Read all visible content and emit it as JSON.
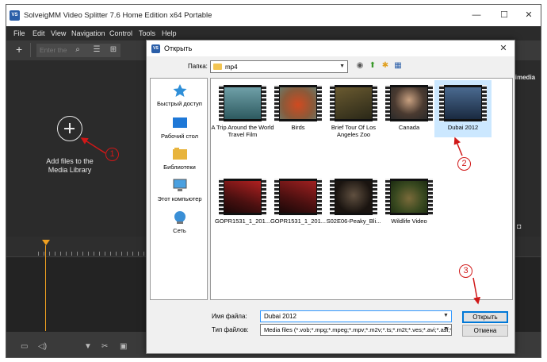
{
  "app": {
    "title": "SolveigMM Video Splitter 7.6 Home Edition x64 Portable",
    "icon_text": "VS",
    "window_buttons": [
      "—",
      "☐",
      "✕"
    ]
  },
  "menu": [
    "File",
    "Edit",
    "View",
    "Navigation",
    "Control",
    "Tools",
    "Help"
  ],
  "toolbar": {
    "search_placeholder": "Enter the"
  },
  "media_library": {
    "add_label_line1": "Add files to the",
    "add_label_line2": "Media Library"
  },
  "right_panel": {
    "label": "ultimedia"
  },
  "dialog": {
    "title": "Открыть",
    "look_in_label": "Папка:",
    "look_in_value": "mp4",
    "places": [
      {
        "label": "Быстрый доступ",
        "icon": "star-icon"
      },
      {
        "label": "Рабочий стол",
        "icon": "desktop-icon"
      },
      {
        "label": "Библиотеки",
        "icon": "library-icon"
      },
      {
        "label": "Этот компьютер",
        "icon": "computer-icon"
      },
      {
        "label": "Сеть",
        "icon": "network-icon"
      }
    ],
    "files": [
      {
        "name": "A Trip Around the World Travel Film",
        "selected": false
      },
      {
        "name": "Birds",
        "selected": false
      },
      {
        "name": "Brief Tour Of Los Angeles Zoo",
        "selected": false
      },
      {
        "name": "Canada",
        "selected": false
      },
      {
        "name": "Dubai 2012",
        "selected": true
      },
      {
        "name": "GOPR1531_1_201...",
        "selected": false
      },
      {
        "name": "GOPR1531_1_201...",
        "selected": false
      },
      {
        "name": "S02E06-Peaky_Bli...",
        "selected": false
      },
      {
        "name": "Wildlife Video",
        "selected": false
      }
    ],
    "file_name_label": "Имя файла:",
    "file_name_value": "Dubai 2012",
    "file_type_label": "Тип файлов:",
    "file_type_value": "Media files (*.vob;*.mpg;*.mpeg;*.mpv;*.m2v;*.ts;*.m2t;*.ves;*.avi;*.asf;*.",
    "open_button": "Открыть",
    "cancel_button": "Отмена"
  },
  "annotations": [
    "1",
    "2",
    "3"
  ],
  "colors": {
    "annotation": "#d01818",
    "selection": "#cce8ff",
    "playhead": "#f0a020"
  }
}
